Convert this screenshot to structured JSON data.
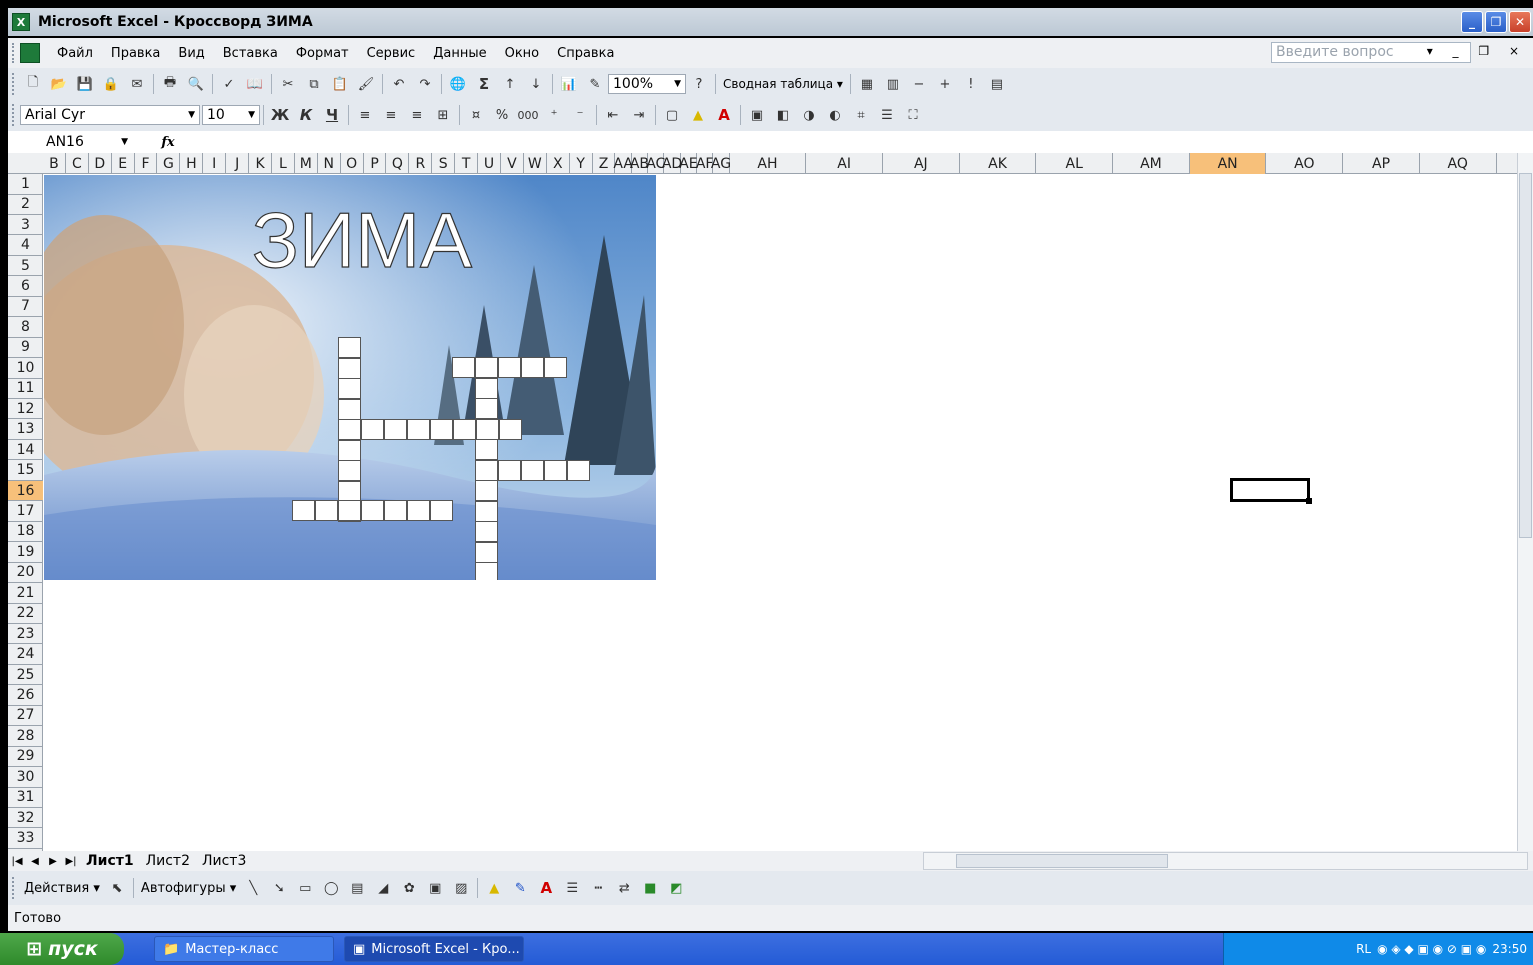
{
  "window": {
    "title": "Microsoft Excel - Кроссворд ЗИМА",
    "minimize": "_",
    "restore": "❐",
    "close": "✕"
  },
  "menu": {
    "items": [
      "Файл",
      "Правка",
      "Вид",
      "Вставка",
      "Формат",
      "Сервис",
      "Данные",
      "Окно",
      "Справка"
    ],
    "help_placeholder": "Введите вопрос",
    "mdi_controls": "▾ _ ❐ ×"
  },
  "toolbar_standard": {
    "zoom": "100%",
    "pivot_label": "Сводная таблица ▾"
  },
  "toolbar_format": {
    "font": "Arial Cyr",
    "size": "10",
    "bold": "Ж",
    "italic": "К",
    "underline": "Ч",
    "percent": "%",
    "thousands": "000"
  },
  "formula_bar": {
    "name_box": "AN16",
    "fx": "fx"
  },
  "columns": [
    "B",
    "C",
    "D",
    "E",
    "F",
    "G",
    "H",
    "I",
    "J",
    "K",
    "L",
    "M",
    "N",
    "O",
    "P",
    "Q",
    "R",
    "S",
    "T",
    "U",
    "V",
    "W",
    "X",
    "Y",
    "Z",
    "AA",
    "AB",
    "AC",
    "AD",
    "AE",
    "AF",
    "AG",
    "AH",
    "AI",
    "AJ",
    "AK",
    "AL",
    "AM",
    "AN",
    "AO",
    "AP",
    "AQ"
  ],
  "active_column": "AN",
  "rows": [
    "1",
    "2",
    "3",
    "4",
    "5",
    "6",
    "7",
    "8",
    "9",
    "10",
    "11",
    "12",
    "13",
    "14",
    "15",
    "16",
    "17",
    "18",
    "19",
    "20",
    "21",
    "22",
    "23",
    "24",
    "25",
    "26",
    "27",
    "28",
    "29",
    "30",
    "31",
    "32",
    "33"
  ],
  "active_row": "16",
  "picture_title": "ЗИМА",
  "sheets": {
    "tabs": [
      "Лист1",
      "Лист2",
      "Лист3"
    ],
    "active": "Лист1"
  },
  "drawing": {
    "actions": "Действия ▾",
    "autoshapes": "Автофигуры ▾"
  },
  "status": "Готово",
  "taskbar": {
    "start": "пуск",
    "tasks": [
      "Мастер-класс",
      "Microsoft Excel - Кро..."
    ],
    "lang": "RL",
    "clock": "23:50"
  }
}
